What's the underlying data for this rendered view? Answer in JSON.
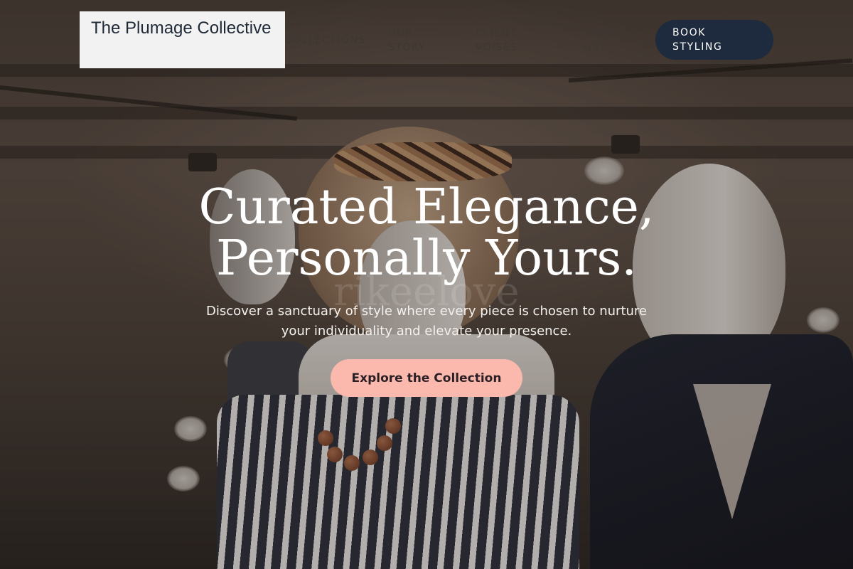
{
  "brand": {
    "name": "The Plumage Collective"
  },
  "nav": {
    "items": [
      {
        "label": "COLLECTIONS"
      },
      {
        "label": "OUR STORY"
      },
      {
        "label": "CLIENT VOISES"
      },
      {
        "label": "VISIT US"
      }
    ],
    "cta_label": "BOOK STYLING"
  },
  "hero": {
    "title_line1": "Curated Elegance,",
    "title_line2": "Personally Yours.",
    "subtitle": "Discover a sanctuary of style where every piece is chosen to nurture your individuality and elevate your presence.",
    "cta_label": "Explore the Collection",
    "watermark": "rikeelove"
  },
  "colors": {
    "logo_bg": "#f2f2f2",
    "book_button_bg": "#1e2a3d",
    "cta_bg": "#fbb9ad",
    "title_text": "#ffffff"
  },
  "background": {
    "description_icon": "mannequins-photo"
  }
}
